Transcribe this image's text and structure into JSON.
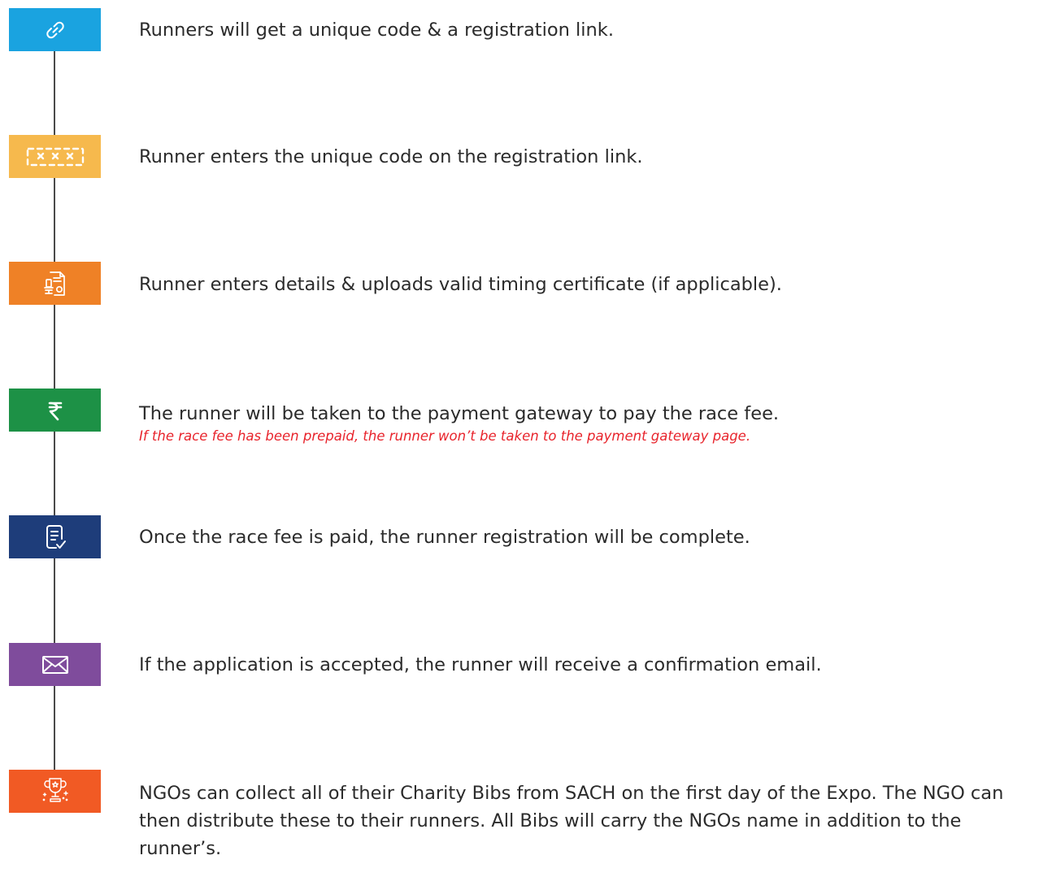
{
  "colors": {
    "line": "#4a4a4a",
    "link_badge": "#1aa3e0",
    "code_badge": "#f6b94d",
    "details_badge": "#ef8126",
    "payment_badge": "#1d9146",
    "complete_badge": "#1e3d7a",
    "email_badge": "#7f4c9c",
    "bibs_badge": "#f15a24",
    "note": "#e8242c"
  },
  "steps": [
    {
      "icon": "link-icon",
      "text": "Runners will get a unique code & a registration link."
    },
    {
      "icon": "code-icon",
      "text": "Runner enters the unique code on the registration link."
    },
    {
      "icon": "certificate-icon",
      "text": "Runner enters details & uploads valid timing certificate (if applicable)."
    },
    {
      "icon": "rupee-icon",
      "text": "The runner will be taken to the payment gateway to pay the race fee.",
      "note": "If the race fee has been prepaid, the runner won’t be taken to the payment gateway page."
    },
    {
      "icon": "checklist-icon",
      "text": "Once the race fee is paid, the runner registration will be complete."
    },
    {
      "icon": "envelope-icon",
      "text": "If the application is accepted, the runner will receive a confirmation email."
    },
    {
      "icon": "trophy-icon",
      "text": "NGOs can collect all of their Charity Bibs from SACH on the first day of the Expo. The NGO can then distribute these to their runners. All Bibs will carry the NGOs name in addition to the runner’s."
    }
  ]
}
